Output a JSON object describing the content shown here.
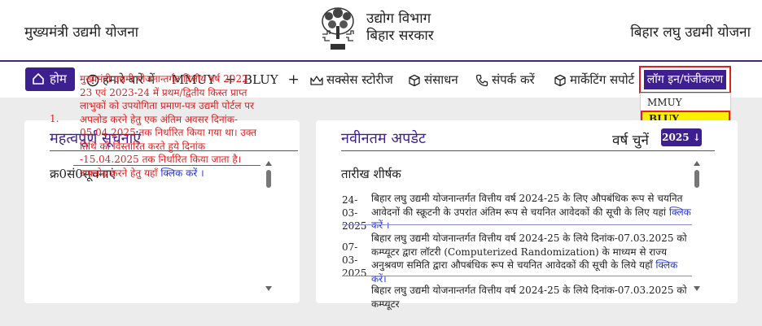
{
  "header": {
    "left_title": "मुख्यमंत्री उद्यमी योजना",
    "dept_line1": "उद्योग विभाग",
    "dept_line2": "बिहार सरकार",
    "right_title": "बिहार लघु उद्यमी योजना",
    "emblem_icon": "bodhi-tree-emblem-icon"
  },
  "nav": {
    "home": "होम",
    "about": "हमारे बारे में",
    "mmuy": "MMUY",
    "bluy": "BLUY",
    "plus": "+",
    "success": "सक्सेस स्टोरीज",
    "resources": "संसाधन",
    "contact": "संपर्क करें",
    "marketing": "मार्केटिंग सपोर्ट",
    "login": "लॉग इन/पंजीकरण",
    "dropdown": [
      "MMUY",
      "BLUY"
    ]
  },
  "notices": {
    "title": "महत्वपूर्ण सूचनाएं",
    "col_num": "क्र0सं0",
    "col_notice": "सूचनाएं",
    "items": [
      {
        "num": "1.",
        "text": "मुख्यमंत्री उद्यमी योजनान्तर्गत वित्तीय वर्ष 2022-23 एवं 2023-24 में प्रथम/द्वितीय किस्त प्राप्त लाभुकों को उपयोगिता प्रमाण-पत्र उद्यमी पोर्टल पर अपलोड करने हेतु एक अंतिम अवसर दिनांक- 05.04.2025 तक निर्धारित किया गया था। उक्त तिथि को विस्तारित करते हुये दिनांक -15.04.2025 तक निर्धारित किया जाता है। अपलोड करने हेतु यहाँ ",
        "link": "क्लिक करें ।"
      }
    ]
  },
  "updates": {
    "title": "नवीनतम अपडेट",
    "year_label": "वर्ष चुनें",
    "year_value": "2025 ↓",
    "col_date": "तारीख",
    "col_title": "शीर्षक",
    "items": [
      {
        "date": "24-03-2025",
        "text": "बिहार लघु उद्यमी योजनान्तर्गत वित्तीय वर्ष 2024-25 के लिए औपबंधिक रूप से चयनित आवेदनों की स्क्रूटनी के उपरांत अंतिम रूप से चयनित आवेदकों की सूची के लिए यहां ",
        "link": "क्लिक करें ।"
      },
      {
        "date": "07-03-2025",
        "text": "बिहार लघु उद्यमी योजनान्तर्गत वित्तीय वर्ष 2024-25 के लिये दिनांक-07.03.2025 को कम्प्यूटर द्वारा लॉटरी (Computerized Randomization) के माध्यम से राज्य अनुश्रवण समिति द्वारा औपबंधिक रूप से चयनित आवेदकों की सूची के लिये यहाँ ",
        "link": "क्लिक करें।"
      },
      {
        "date": "",
        "text": "बिहार लघु उद्यमी योजनान्तर्गत वित्तीय वर्ष 2024-25 के लिये दिनांक-07.03.2025 को कम्प्यूटर",
        "link": ""
      }
    ]
  },
  "colors": {
    "brand": "#3e1f8f",
    "alert": "#e02020",
    "link": "#2233cc",
    "highlight": "#f8f000",
    "background": "#ececec"
  }
}
